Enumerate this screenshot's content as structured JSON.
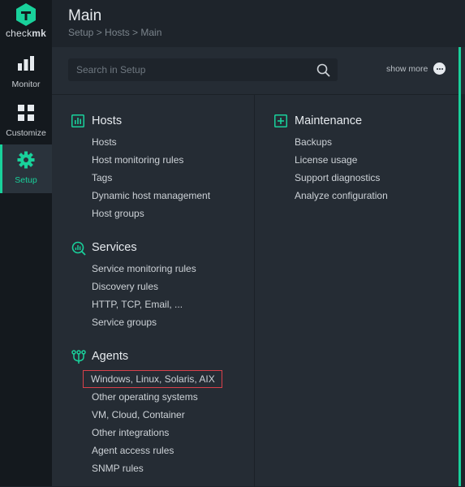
{
  "nav": {
    "logo": {
      "text_light": "check",
      "text_bold": "mk"
    },
    "items": [
      {
        "label": "Monitor",
        "icon": "bar-chart-icon"
      },
      {
        "label": "Customize",
        "icon": "grid-icon"
      },
      {
        "label": "Setup",
        "icon": "gear-icon",
        "active": true
      }
    ]
  },
  "header": {
    "title": "Main",
    "breadcrumb": "Setup > Hosts > Main"
  },
  "search": {
    "placeholder": "Search in Setup",
    "show_more": "show more"
  },
  "colors": {
    "accent": "#19d19b",
    "highlight_border": "#d9404a",
    "nav_bg": "#14191e",
    "content_bg": "#252c34"
  },
  "sections": {
    "hosts": {
      "title": "Hosts",
      "icon": "hosts-icon",
      "items": [
        "Hosts",
        "Host monitoring rules",
        "Tags",
        "Dynamic host management",
        "Host groups"
      ]
    },
    "services": {
      "title": "Services",
      "icon": "services-icon",
      "items": [
        "Service monitoring rules",
        "Discovery rules",
        "HTTP, TCP, Email, ...",
        "Service groups"
      ]
    },
    "agents": {
      "title": "Agents",
      "icon": "agents-icon",
      "items": [
        "Windows, Linux, Solaris, AIX",
        "Other operating systems",
        "VM, Cloud, Container",
        "Other integrations",
        "Agent access rules",
        "SNMP rules"
      ]
    },
    "maintenance": {
      "title": "Maintenance",
      "icon": "maintenance-icon",
      "items": [
        "Backups",
        "License usage",
        "Support diagnostics",
        "Analyze configuration"
      ]
    }
  }
}
